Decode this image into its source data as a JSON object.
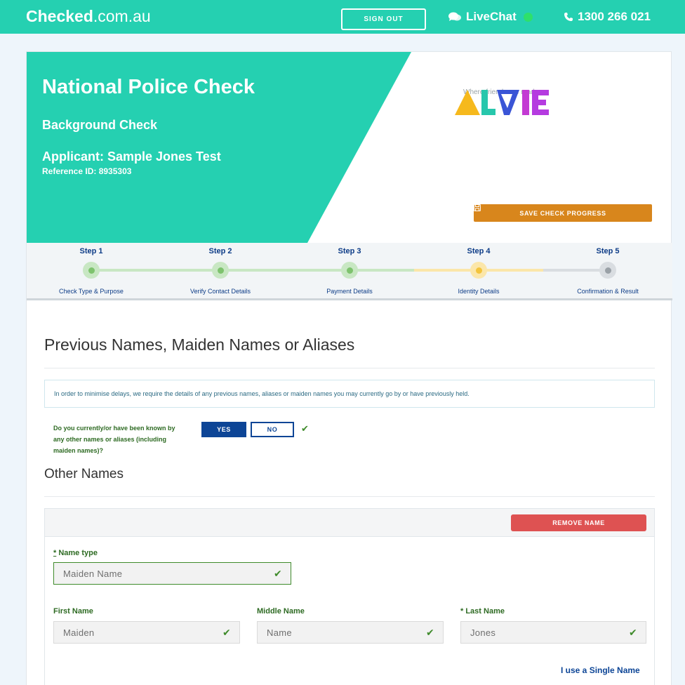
{
  "header": {
    "logo_bold": "Checked",
    "logo_rest": ".com.au",
    "sign_out": "SIGN OUT",
    "livechat": "LiveChat",
    "phone": "1300 266 021"
  },
  "hero": {
    "title": "National Police Check",
    "subtitle": "Background Check",
    "applicant": "Applicant: Sample Jones Test",
    "reference": "Reference ID: 8935303",
    "brand_tagline": "Where friends are made",
    "save_button": "SAVE CHECK PROGRESS"
  },
  "steps": [
    {
      "label": "Step 1",
      "desc": "Check Type & Purpose",
      "state": "done"
    },
    {
      "label": "Step 2",
      "desc": "Verify Contact Details",
      "state": "done"
    },
    {
      "label": "Step 3",
      "desc": "Payment Details",
      "state": "done"
    },
    {
      "label": "Step 4",
      "desc": "Identity Details",
      "state": "current"
    },
    {
      "label": "Step 5",
      "desc": "Confirmation & Result",
      "state": "pending"
    }
  ],
  "section": {
    "title": "Previous Names, Maiden Names or Aliases",
    "info": "In order to minimise delays, we require the details of any previous names, aliases or maiden names you may currently go by or have previously held.",
    "question": "Do you currently/or have been known by any other names or aliases (including maiden names)?",
    "yes": "YES",
    "no": "NO",
    "other_names_title": "Other Names"
  },
  "name_entry": {
    "remove_button": "REMOVE NAME",
    "name_type_label": "Name type",
    "name_type_value": "Maiden Name",
    "first_name_label": "First Name",
    "first_name_value": "Maiden",
    "middle_name_label": "Middle Name",
    "middle_name_value": "Name",
    "last_name_label": "* Last Name",
    "last_name_value": "Jones",
    "single_name_link": "I use a Single Name"
  },
  "colors": {
    "brand_teal": "#25d0b1",
    "navy": "#0d4596",
    "save_orange": "#d8861c",
    "remove_red": "#de5252",
    "label_green": "#2d6a22"
  }
}
